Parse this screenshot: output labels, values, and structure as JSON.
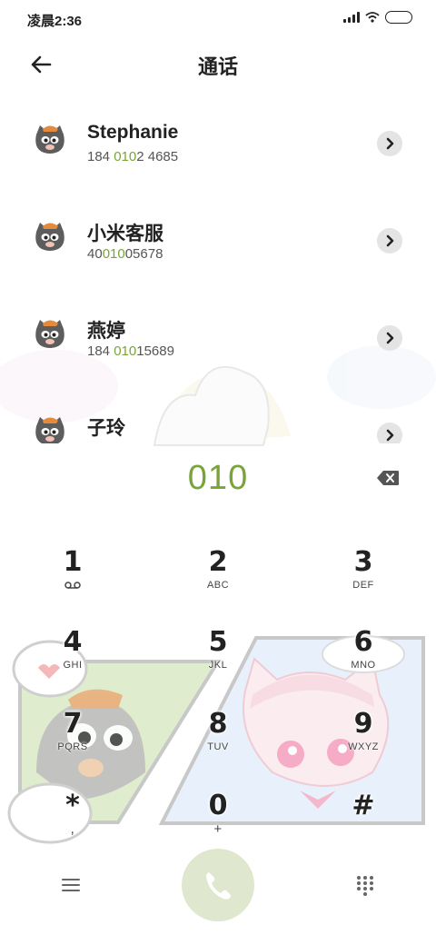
{
  "status_bar": {
    "time": "凌晨2:36",
    "icons": [
      "signal-icon",
      "wifi-icon",
      "battery-icon"
    ]
  },
  "header": {
    "title": "通话",
    "back_icon": "back-arrow-icon"
  },
  "contacts": [
    {
      "name": "Stephanie",
      "number_parts": [
        "184 ",
        "010",
        "2 4685"
      ],
      "avatar": "cartoon-cat-avatar"
    },
    {
      "name": "小米客服",
      "number_parts": [
        "40",
        "010",
        "05678"
      ],
      "avatar": "cartoon-cat-avatar"
    },
    {
      "name": "燕婷",
      "number_parts": [
        "184 ",
        "010",
        "15689"
      ],
      "avatar": "cartoon-cat-avatar"
    },
    {
      "name": "子玲",
      "number_parts": [
        "",
        "",
        ""
      ],
      "avatar": "cartoon-cat-avatar"
    }
  ],
  "dialer": {
    "entered_number": "010"
  },
  "keypad": [
    {
      "digit": "1",
      "letters": ""
    },
    {
      "digit": "2",
      "letters": "ABC"
    },
    {
      "digit": "3",
      "letters": "DEF"
    },
    {
      "digit": "4",
      "letters": "GHI"
    },
    {
      "digit": "5",
      "letters": "JKL"
    },
    {
      "digit": "6",
      "letters": "MNO"
    },
    {
      "digit": "7",
      "letters": "PQRS"
    },
    {
      "digit": "8",
      "letters": "TUV"
    },
    {
      "digit": "9",
      "letters": "WXYZ"
    },
    {
      "digit": "*",
      "letters": ","
    },
    {
      "digit": "0",
      "letters": "+"
    },
    {
      "digit": "#",
      "letters": ""
    }
  ],
  "colors": {
    "accent": "#7aa43a",
    "call_button_bg": "#dfe8cf",
    "detail_button_bg": "#e4e4e4"
  }
}
